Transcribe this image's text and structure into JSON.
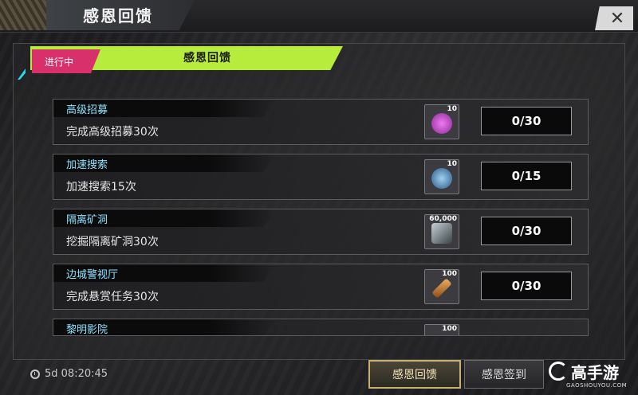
{
  "header": {
    "title": "感恩回馈"
  },
  "banner": {
    "status": "进行中",
    "title": "感恩回馈"
  },
  "tasks": [
    {
      "title": "高级招募",
      "desc": "完成高级招募30次",
      "reward_qty": "10",
      "progress": "0/30",
      "icon": "purple-coin-icon",
      "color": "#c23fd0"
    },
    {
      "title": "加速搜索",
      "desc": "加速搜索15次",
      "reward_qty": "10",
      "progress": "0/15",
      "icon": "blue-coin-icon",
      "color": "#4a8ad0"
    },
    {
      "title": "隔离矿洞",
      "desc": "挖掘隔离矿洞30次",
      "reward_qty": "60,000",
      "progress": "0/30",
      "icon": "crystal-icon",
      "color": "#6a7a80"
    },
    {
      "title": "边城警视厅",
      "desc": "完成悬赏任务30次",
      "reward_qty": "100",
      "progress": "0/30",
      "icon": "drill-icon",
      "color": "#d08a3a"
    },
    {
      "title": "黎明影院",
      "desc": "",
      "reward_qty": "100",
      "progress": "",
      "icon": "item-icon",
      "color": "#555555"
    }
  ],
  "footer": {
    "timer": "5d 08:20:45",
    "tab_active": "感恩回馈",
    "tab_other": "感恩签到"
  },
  "watermark": {
    "brand": "高手游",
    "site": "GAOSHOUYOU.COM"
  }
}
